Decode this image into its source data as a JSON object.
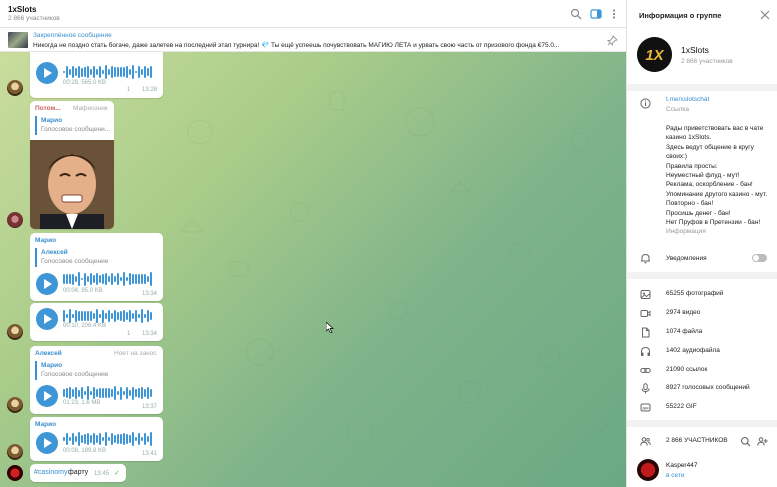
{
  "header": {
    "title": "1xSlots",
    "subtitle": "2 866 участников"
  },
  "pinned": {
    "title": "Закреплённое сообщение",
    "text": "Никогда не поздно стать богаче, даже залетев на последний этап турнира! 💎 Ты ещё успеешь почувствовать МАГИЮ ЛЕТА и урвать свою часть от призового фонда €75.0..."
  },
  "messages": {
    "m1": {
      "meta": "00:28, 565.0 KB",
      "fwd": "1",
      "time": "13:28"
    },
    "m2": {
      "sender": "Потом...",
      "role": "Мафиозник",
      "quote_name": "Марио",
      "quote_text": "Голосовое сообщени..."
    },
    "m3": {
      "sender": "Марио",
      "quote_name": "Алексей",
      "quote_text": "Голосовое сообщение",
      "meta": "00:04, 95.0 KB",
      "time": "13:34"
    },
    "m4": {
      "meta": "00:10, 208.4 KB",
      "fwd": "1",
      "time": "13:34"
    },
    "m5": {
      "sender": "Алексей",
      "role": "Ноет на занос",
      "quote_name": "Марио",
      "quote_text": "Голосовое сообщение",
      "meta": "01:23, 1.6 MB",
      "time": "13:37"
    },
    "m6": {
      "sender": "Марио",
      "meta": "00:08, 189.8 KB",
      "time": "13:41"
    },
    "m7": {
      "hashtag": "#casinomy",
      "text": " фарту",
      "time": "13:45"
    }
  },
  "panel": {
    "title": "Информация о группе",
    "group_name": "1xSlots",
    "group_count": "2 866 участников",
    "logo_text": "1X",
    "link": "t.me/xslotschat",
    "link_label": "Ссылка",
    "description": "Рады приветствовать вас в чате казино 1xSlots.\nЗдесь ведут общение в кругу своих:)\nПравила просты:\nНеуместный флуд - мут!\nРеклама, оскорбление - бан!\nУпоминание другого казино - мут. Повторно - бан!\nПросишь денег - бан!\nНет Пруфов в Претензии - бан!",
    "description_label": "Информация",
    "notifications": "Уведомления",
    "media": [
      "65255 фотографий",
      "2974 видео",
      "1074 файла",
      "1402 аудиофайла",
      "21090 ссылок",
      "8927 голосовых сообщений",
      "55222 GIF"
    ],
    "members_header": "2 866 УЧАСТНИКОВ",
    "member_name": "Kasper447",
    "member_status": "в сети"
  },
  "colors": {
    "accent": "#3e96d6",
    "link": "#3a8fd0",
    "online": "#3a8fd0",
    "tag_bg": "#4aa3df"
  },
  "icons": [
    "search-icon",
    "sidebar-toggle-icon",
    "more-vertical-icon",
    "unpin-icon",
    "info-icon",
    "bell-icon",
    "photo-icon",
    "video-icon",
    "file-icon",
    "headphones-icon",
    "link-icon",
    "mic-icon",
    "gif-icon",
    "members-icon",
    "add-member-icon",
    "close-icon",
    "play-icon"
  ]
}
